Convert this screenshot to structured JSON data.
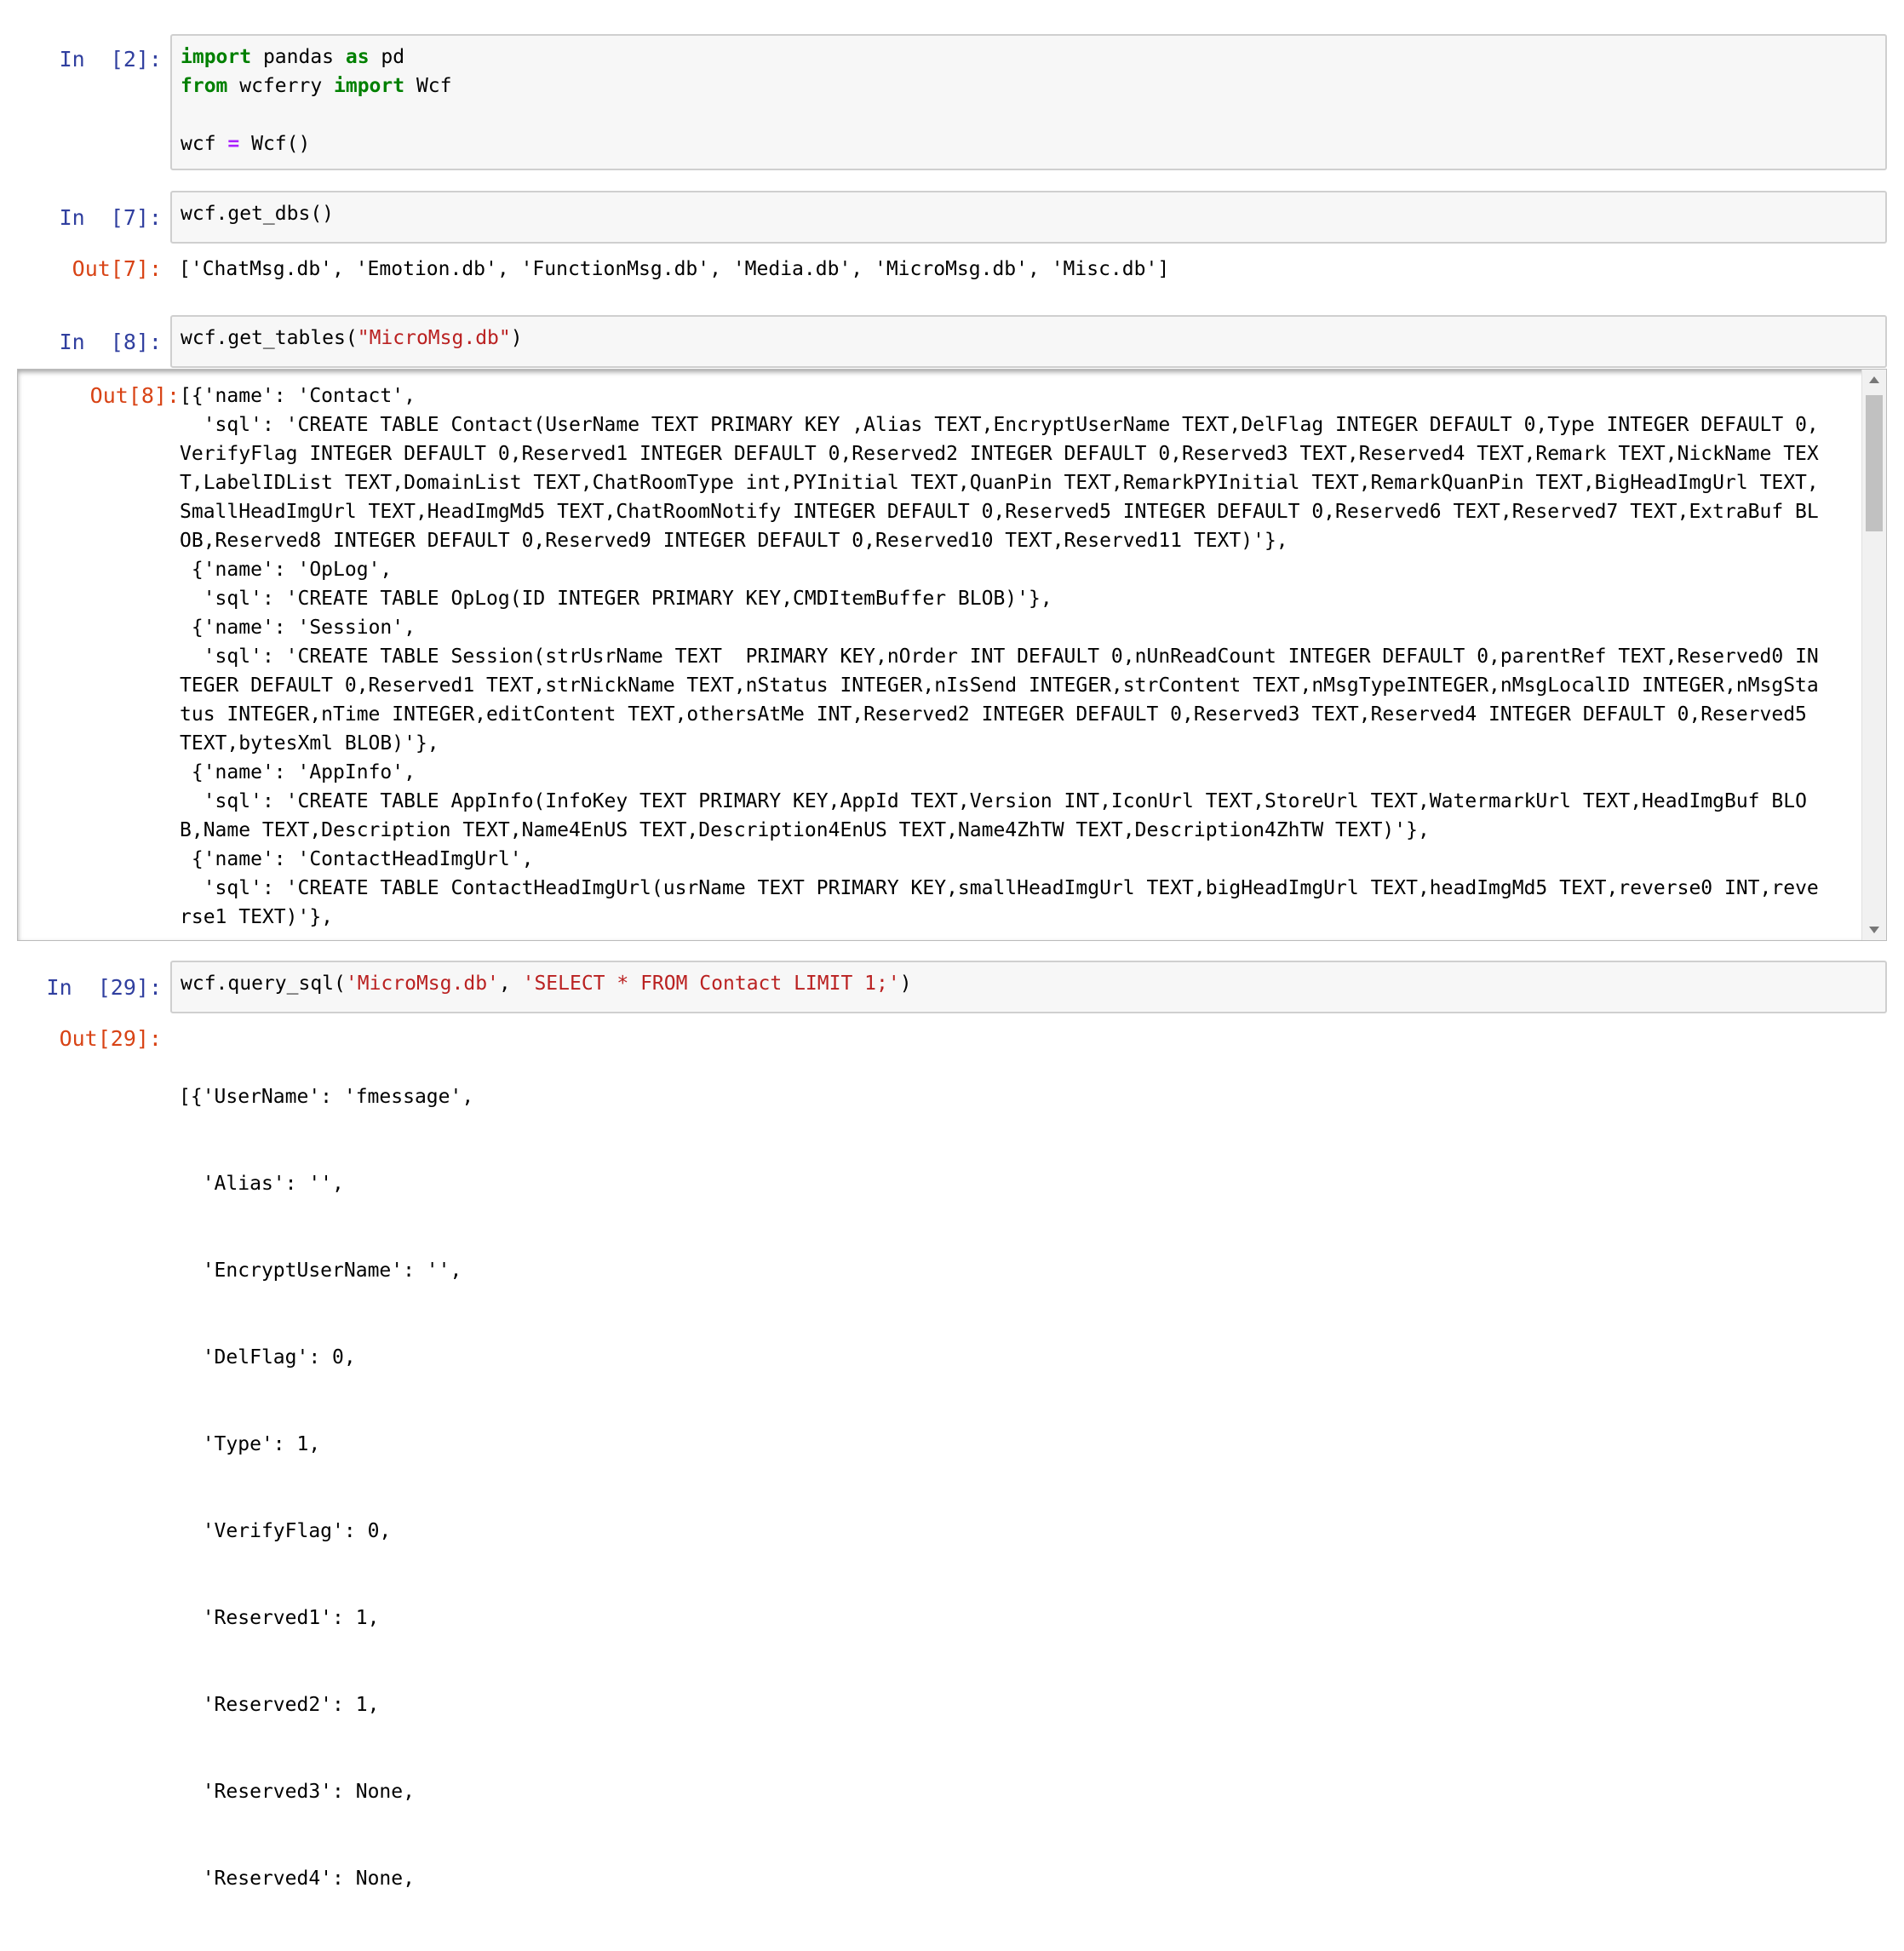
{
  "cells": [
    {
      "in_prompt": "In  [2]:",
      "code": [
        "import pandas as pd",
        "from wcferry import Wcf",
        "",
        "wcf = Wcf()"
      ]
    },
    {
      "in_prompt": "In  [7]:",
      "code": [
        "wcf.get_dbs()"
      ],
      "out_prompt": "Out[7]:",
      "output": "['ChatMsg.db', 'Emotion.db', 'FunctionMsg.db', 'Media.db', 'MicroMsg.db', 'Misc.db']"
    },
    {
      "in_prompt": "In  [8]:",
      "code_prefix": "wcf.get_tables(",
      "code_string": "\"MicroMsg.db\"",
      "code_suffix": ")",
      "out_prompt": "Out[8]:",
      "output_lines": [
        "[{'name': 'Contact',",
        "  'sql': 'CREATE TABLE Contact(UserName TEXT PRIMARY KEY ,Alias TEXT,EncryptUserName TEXT,DelFlag INTEGER DEFAULT 0,Type INTEGER DEFAULT 0,VerifyFlag INTEGER DEFAULT 0,Reserved1 INTEGER DEFAULT 0,Reserved2 INTEGER DEFAULT 0,Reserved3 TEXT,Reserved4 TEXT,Remark TEXT,NickName TEXT,LabelIDList TEXT,DomainList TEXT,ChatRoomType int,PYInitial TEXT,QuanPin TEXT,RemarkPYInitial TEXT,RemarkQuanPin TEXT,BigHeadImgUrl TEXT,SmallHeadImgUrl TEXT,HeadImgMd5 TEXT,ChatRoomNotify INTEGER DEFAULT 0,Reserved5 INTEGER DEFAULT 0,Reserved6 TEXT,Reserved7 TEXT,ExtraBuf BLOB,Reserved8 INTEGER DEFAULT 0,Reserved9 INTEGER DEFAULT 0,Reserved10 TEXT,Reserved11 TEXT)'},",
        " {'name': 'OpLog',",
        "  'sql': 'CREATE TABLE OpLog(ID INTEGER PRIMARY KEY,CMDItemBuffer BLOB)'},",
        " {'name': 'Session',",
        "  'sql': 'CREATE TABLE Session(strUsrName TEXT  PRIMARY KEY,nOrder INT DEFAULT 0,nUnReadCount INTEGER DEFAULT 0,parentRef TEXT,Reserved0 INTEGER DEFAULT 0,Reserved1 TEXT,strNickName TEXT,nStatus INTEGER,nIsSend INTEGER,strContent TEXT,nMsgTypeINTEGER,nMsgLocalID INTEGER,nMsgStatus INTEGER,nTime INTEGER,editContent TEXT,othersAtMe INT,Reserved2 INTEGER DEFAULT 0,Reserved3 TEXT,Reserved4 INTEGER DEFAULT 0,Reserved5 TEXT,bytesXml BLOB)'},",
        " {'name': 'AppInfo',",
        "  'sql': 'CREATE TABLE AppInfo(InfoKey TEXT PRIMARY KEY,AppId TEXT,Version INT,IconUrl TEXT,StoreUrl TEXT,WatermarkUrl TEXT,HeadImgBuf BLOB,Name TEXT,Description TEXT,Name4EnUS TEXT,Description4EnUS TEXT,Name4ZhTW TEXT,Description4ZhTW TEXT)'},",
        " {'name': 'ContactHeadImgUrl',",
        "  'sql': 'CREATE TABLE ContactHeadImgUrl(usrName TEXT PRIMARY KEY,smallHeadImgUrl TEXT,bigHeadImgUrl TEXT,headImgMd5 TEXT,reverse0 INT,reverse1 TEXT)'},"
      ]
    },
    {
      "in_prompt": "In  [29]:",
      "code_prefix": "wcf.query_sql(",
      "code_string1": "'MicroMsg.db'",
      "code_mid": ", ",
      "code_string2": "'SELECT * FROM Contact LIMIT 1;'",
      "code_suffix": ")",
      "out_prompt": "Out[29]:",
      "output_lines": [
        "[{'UserName': 'fmessage',",
        "  'Alias': '',",
        "  'EncryptUserName': '',",
        "  'DelFlag': 0,",
        "  'Type': 1,",
        "  'VerifyFlag': 0,",
        "  'Reserved1': 1,",
        "  'Reserved2': 1,",
        "  'Reserved3': None,",
        "  'Reserved4': None,"
      ]
    }
  ],
  "colors": {
    "in_prompt": "#303f9f",
    "out_prompt": "#d84315",
    "keyword": "#008000",
    "string": "#ba2121",
    "input_bg": "#f7f7f7"
  }
}
